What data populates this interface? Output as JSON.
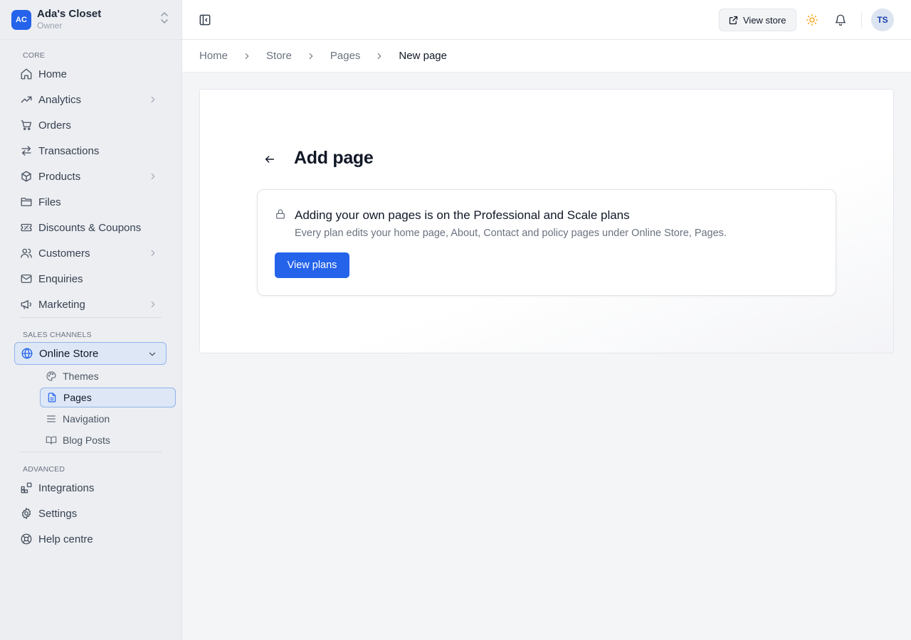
{
  "store": {
    "initials": "AC",
    "name": "Ada's Closet",
    "role": "Owner"
  },
  "sections": {
    "core": "CORE",
    "sales": "SALES CHANNELS",
    "advanced": "ADVANCED"
  },
  "nav": {
    "home": "Home",
    "analytics": "Analytics",
    "orders": "Orders",
    "transactions": "Transactions",
    "products": "Products",
    "files": "Files",
    "discounts": "Discounts & Coupons",
    "customers": "Customers",
    "enquiries": "Enquiries",
    "marketing": "Marketing",
    "online_store": "Online Store",
    "integrations": "Integrations",
    "settings": "Settings",
    "help": "Help centre"
  },
  "online_store_sub": {
    "themes": "Themes",
    "pages": "Pages",
    "navigation": "Navigation",
    "blog": "Blog Posts"
  },
  "topbar": {
    "view_store": "View store",
    "user_initials": "TS"
  },
  "breadcrumb": {
    "home": "Home",
    "store": "Store",
    "pages": "Pages",
    "current": "New page"
  },
  "main": {
    "title": "Add page",
    "notice_title": "Adding your own pages is on the Professional and Scale plans",
    "notice_desc": "Every plan edits your home page, About, Contact and policy pages under Online Store, Pages.",
    "cta": "View plans"
  },
  "colors": {
    "accent": "#2563eb",
    "sun": "#f59e0b"
  }
}
